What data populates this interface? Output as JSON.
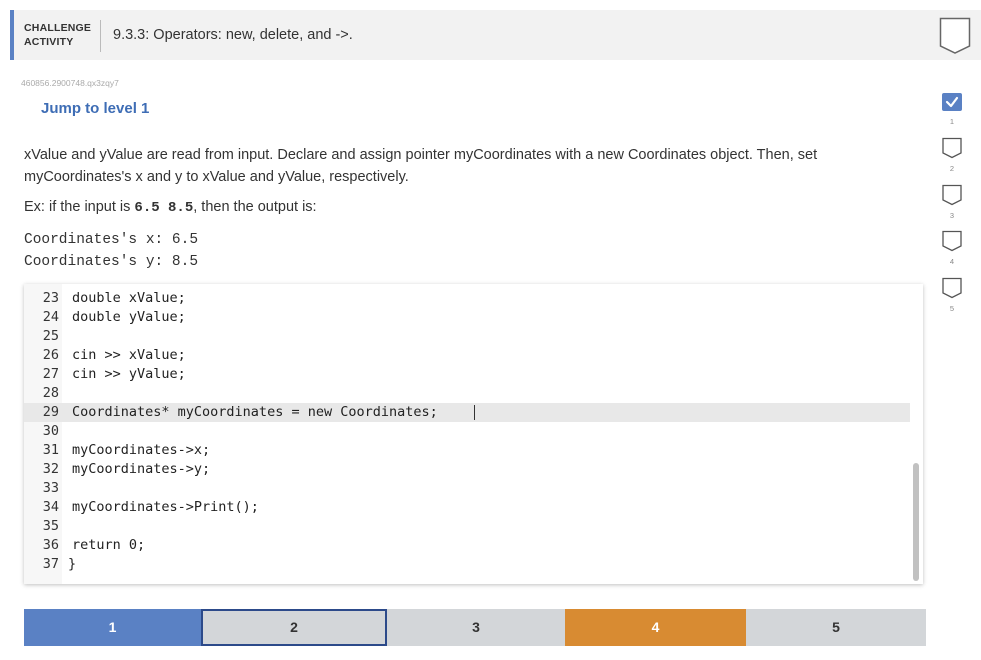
{
  "header": {
    "label_line1": "CHALLENGE",
    "label_line2": "ACTIVITY",
    "title": "9.3.3: Operators: new, delete, and ->."
  },
  "activity_id": "460856.2900748.qx3zqy7",
  "jump_link": "Jump to level 1",
  "prompt_line1": "xValue and yValue are read from input. Declare and assign pointer myCoordinates with a new Coordinates object. Then, set",
  "prompt_line2": "myCoordinates's x and y to xValue and yValue, respectively.",
  "example": {
    "prefix": "Ex: if the input is ",
    "input": "6.5 8.5",
    "suffix": ", then the output is:"
  },
  "output_lines": [
    "Coordinates's x: 6.5",
    "Coordinates's y: 8.5"
  ],
  "code_lines": [
    {
      "num": "23",
      "text": "double xValue;"
    },
    {
      "num": "24",
      "text": "double yValue;"
    },
    {
      "num": "25",
      "text": ""
    },
    {
      "num": "26",
      "text": "cin >> xValue;"
    },
    {
      "num": "27",
      "text": "cin >> yValue;"
    },
    {
      "num": "28",
      "text": ""
    },
    {
      "num": "29",
      "text": "Coordinates* myCoordinates = new Coordinates;"
    },
    {
      "num": "30",
      "text": ""
    },
    {
      "num": "31",
      "text": "myCoordinates->x;"
    },
    {
      "num": "32",
      "text": "myCoordinates->y;"
    },
    {
      "num": "33",
      "text": ""
    },
    {
      "num": "34",
      "text": "myCoordinates->Print();"
    },
    {
      "num": "35",
      "text": ""
    },
    {
      "num": "36",
      "text": "return 0;"
    },
    {
      "num": "37",
      "text": "}"
    }
  ],
  "side_levels": [
    "1",
    "2",
    "3",
    "4",
    "5"
  ],
  "level_buttons": [
    {
      "label": "1",
      "state": "complete"
    },
    {
      "label": "2",
      "state": "current"
    },
    {
      "label": "3",
      "state": "default"
    },
    {
      "label": "4",
      "state": "attempted"
    },
    {
      "label": "5",
      "state": "default"
    }
  ],
  "colors": {
    "accent_blue": "#5a81c4",
    "link_blue": "#3e6db5",
    "level_complete": "#5a81c4",
    "level_attempted": "#d88b32",
    "level_default": "#d3d6d9",
    "current_border": "#2c4a8a"
  },
  "icons": {
    "header_badge": "chevron-badge-icon",
    "completed_level": "checkmark-icon",
    "pending_level": "empty-badge-icon"
  }
}
